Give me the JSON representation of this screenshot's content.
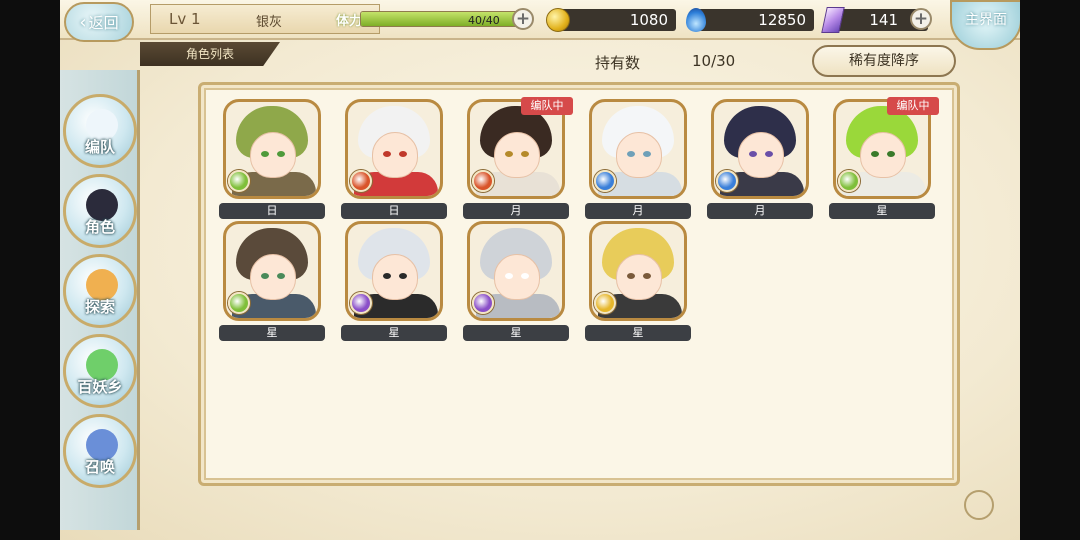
{
  "colors": {
    "accent_gold": "#c9ad72",
    "nameplate": "#3c3f44",
    "badge_red": "#d64a4a",
    "stamina_green": "#7fae27"
  },
  "header": {
    "back_label": "返回",
    "level": "Lv 1",
    "player_name": "银灰",
    "stamina_label": "体力",
    "stamina_value": "40/40",
    "stamina_fraction": 1.0,
    "coins": "1080",
    "soul": "12850",
    "gems": "141",
    "home_label": "主界面"
  },
  "subheader": {
    "tab_label": "角色列表",
    "count_label": "持有数",
    "count_value": "10/30",
    "sort_label": "稀有度降序"
  },
  "nav": {
    "items": [
      {
        "label": "编队",
        "icon": "ghost-icon",
        "color": "#eef6fb"
      },
      {
        "label": "角色",
        "icon": "character-icon",
        "color": "#2b2b3b"
      },
      {
        "label": "探索",
        "icon": "explore-icon",
        "color": "#f0b050"
      },
      {
        "label": "百妖乡",
        "icon": "village-icon",
        "color": "#6fcf6a"
      },
      {
        "label": "召唤",
        "icon": "summon-icon",
        "color": "#6a8fd8"
      }
    ]
  },
  "characters": [
    {
      "rank": "日",
      "element": "wind",
      "elem_color": "#7fbf3a",
      "hair": "#8fa84a",
      "eye": "#4f9a3a",
      "outfit": "#7a6a4a",
      "in_team": false
    },
    {
      "rank": "日",
      "element": "fire",
      "elem_color": "#d9542a",
      "hair": "#f2f2f2",
      "eye": "#c0392b",
      "outfit": "#d23a3a",
      "in_team": false
    },
    {
      "rank": "月",
      "element": "fire",
      "elem_color": "#d9542a",
      "hair": "#3a2a22",
      "eye": "#b58a2a",
      "outfit": "#e8e1d6",
      "in_team": true,
      "badge": "编队中"
    },
    {
      "rank": "月",
      "element": "water",
      "elem_color": "#3a7fd9",
      "hair": "#f4f6f8",
      "eye": "#6fa0b8",
      "outfit": "#d6dde2",
      "in_team": false
    },
    {
      "rank": "月",
      "element": "water",
      "elem_color": "#3a7fd9",
      "hair": "#2e2f4a",
      "eye": "#6a4fa8",
      "outfit": "#3a3a48",
      "in_team": false
    },
    {
      "rank": "星",
      "element": "wind",
      "elem_color": "#7fbf3a",
      "hair": "#9ad83a",
      "eye": "#3a7a2a",
      "outfit": "#ecebe4",
      "in_team": true,
      "badge": "编队中"
    },
    {
      "rank": "星",
      "element": "wind",
      "elem_color": "#7fbf3a",
      "hair": "#5a4a3a",
      "eye": "#4a8a5a",
      "outfit": "#4a5a6a",
      "in_team": false
    },
    {
      "rank": "星",
      "element": "dark",
      "elem_color": "#8a4fc8",
      "hair": "#dfe4ea",
      "eye": "#2a2a2a",
      "outfit": "#2b2b2b",
      "in_team": false
    },
    {
      "rank": "星",
      "element": "dark",
      "elem_color": "#8a4fc8",
      "hair": "#cfd3d8",
      "eye": "#ffffff",
      "outfit": "#b8bcc2",
      "in_team": false
    },
    {
      "rank": "星",
      "element": "light",
      "elem_color": "#e6b62a",
      "hair": "#e8cc5a",
      "eye": "#7a5a3a",
      "outfit": "#3a3a3a",
      "in_team": false
    }
  ]
}
